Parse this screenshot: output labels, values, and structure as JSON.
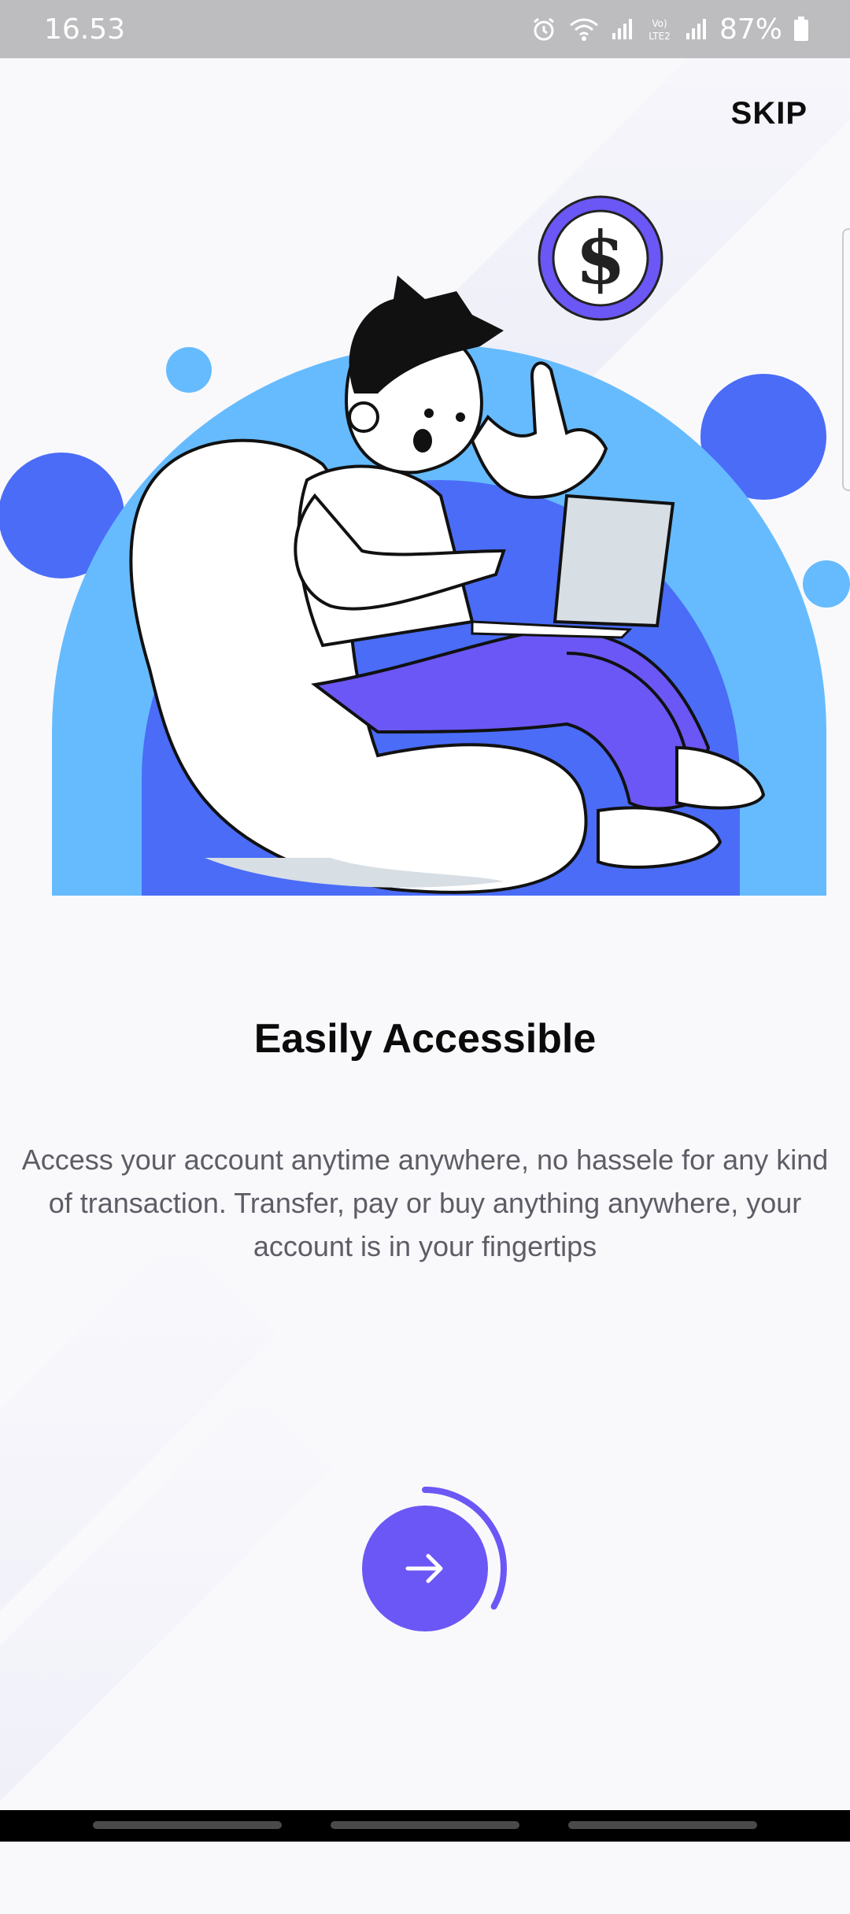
{
  "status_bar": {
    "time": "16.53",
    "battery": "87%",
    "icons": [
      "alarm-icon",
      "wifi-icon",
      "signal-icon",
      "volte-icon",
      "signal-icon-2",
      "battery-icon"
    ]
  },
  "header": {
    "skip_label": "SKIP"
  },
  "content": {
    "title": "Easily Accessible",
    "description": "Access your account anytime anywhere, no hassele for any kind of transaction. Transfer, pay or buy anything anywhere, your account is in your fingertips"
  },
  "next_button": {
    "icon": "arrow-right-icon",
    "progress": 0.33
  },
  "colors": {
    "accent": "#6b57f5",
    "blue_dark": "#4a6cf7",
    "blue_light": "#66bbff",
    "background": "#f9f9fc"
  }
}
